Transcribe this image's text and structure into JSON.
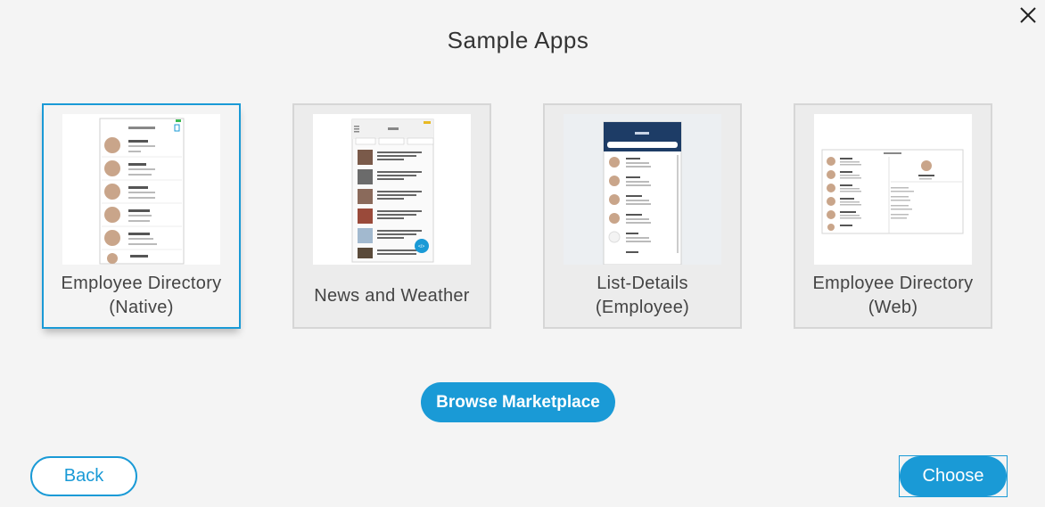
{
  "dialog": {
    "title": "Sample Apps",
    "close_icon": "close-icon"
  },
  "apps": [
    {
      "label": "Employee Directory (Native)",
      "selected": true
    },
    {
      "label": "News and Weather",
      "selected": false
    },
    {
      "label": "List-Details (Employee)",
      "selected": false
    },
    {
      "label": "Employee Directory (Web)",
      "selected": false
    }
  ],
  "buttons": {
    "browse_marketplace": "Browse Marketplace",
    "back": "Back",
    "choose": "Choose"
  },
  "colors": {
    "accent": "#1a9ad6",
    "background": "#f4f4f4"
  }
}
